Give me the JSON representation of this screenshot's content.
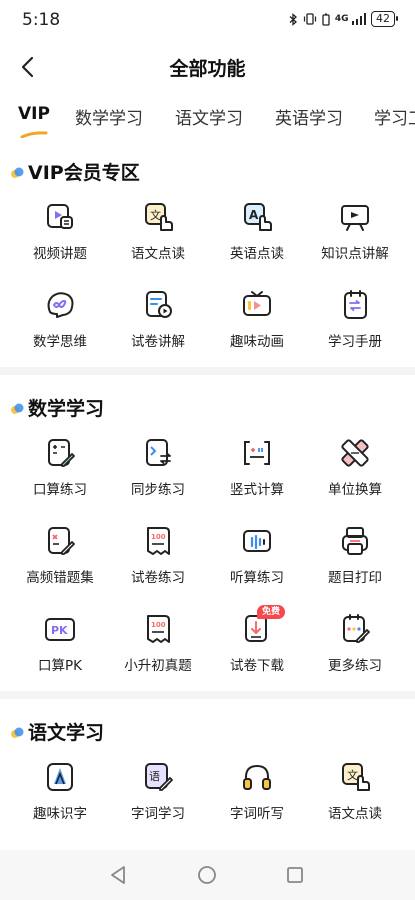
{
  "status": {
    "time": "5:18",
    "network": "4G",
    "battery": "42"
  },
  "header": {
    "title": "全部功能"
  },
  "tabs": [
    {
      "label": "VIP"
    },
    {
      "label": "数学学习"
    },
    {
      "label": "语文学习"
    },
    {
      "label": "英语学习"
    },
    {
      "label": "学习工"
    }
  ],
  "colors": {
    "accent": "#f5a524",
    "dot_blue": "#3b8df0",
    "dot_yellow": "#f7c744",
    "badge": "#f5494d"
  },
  "sections": {
    "vip": {
      "title": "VIP会员专区",
      "items": [
        {
          "label": "视频讲题",
          "icon": "video-lesson-icon"
        },
        {
          "label": "语文点读",
          "icon": "chinese-tap-read-icon"
        },
        {
          "label": "英语点读",
          "icon": "english-tap-read-icon"
        },
        {
          "label": "知识点讲解",
          "icon": "knowledge-explain-icon"
        },
        {
          "label": "数学思维",
          "icon": "math-thinking-icon"
        },
        {
          "label": "试卷讲解",
          "icon": "exam-explain-icon"
        },
        {
          "label": "趣味动画",
          "icon": "animation-icon"
        },
        {
          "label": "学习手册",
          "icon": "study-handbook-icon"
        }
      ]
    },
    "math": {
      "title": "数学学习",
      "items": [
        {
          "label": "口算练习",
          "icon": "mental-math-icon"
        },
        {
          "label": "同步练习",
          "icon": "sync-practice-icon"
        },
        {
          "label": "竖式计算",
          "icon": "vertical-calc-icon"
        },
        {
          "label": "单位换算",
          "icon": "unit-convert-icon"
        },
        {
          "label": "高频错题集",
          "icon": "error-book-icon"
        },
        {
          "label": "试卷练习",
          "icon": "exam-practice-icon"
        },
        {
          "label": "听算练习",
          "icon": "listen-calc-icon"
        },
        {
          "label": "题目打印",
          "icon": "print-icon"
        },
        {
          "label": "口算PK",
          "icon": "pk-icon"
        },
        {
          "label": "小升初真题",
          "icon": "entrance-exam-icon"
        },
        {
          "label": "试卷下载",
          "icon": "download-exam-icon",
          "badge": "免费"
        },
        {
          "label": "更多练习",
          "icon": "more-practice-icon"
        }
      ]
    },
    "chinese": {
      "title": "语文学习",
      "items": [
        {
          "label": "趣味识字",
          "icon": "character-learn-icon"
        },
        {
          "label": "字词学习",
          "icon": "word-study-icon"
        },
        {
          "label": "字词听写",
          "icon": "dictation-icon"
        },
        {
          "label": "语文点读",
          "icon": "chinese-tap-read-icon"
        }
      ]
    }
  }
}
